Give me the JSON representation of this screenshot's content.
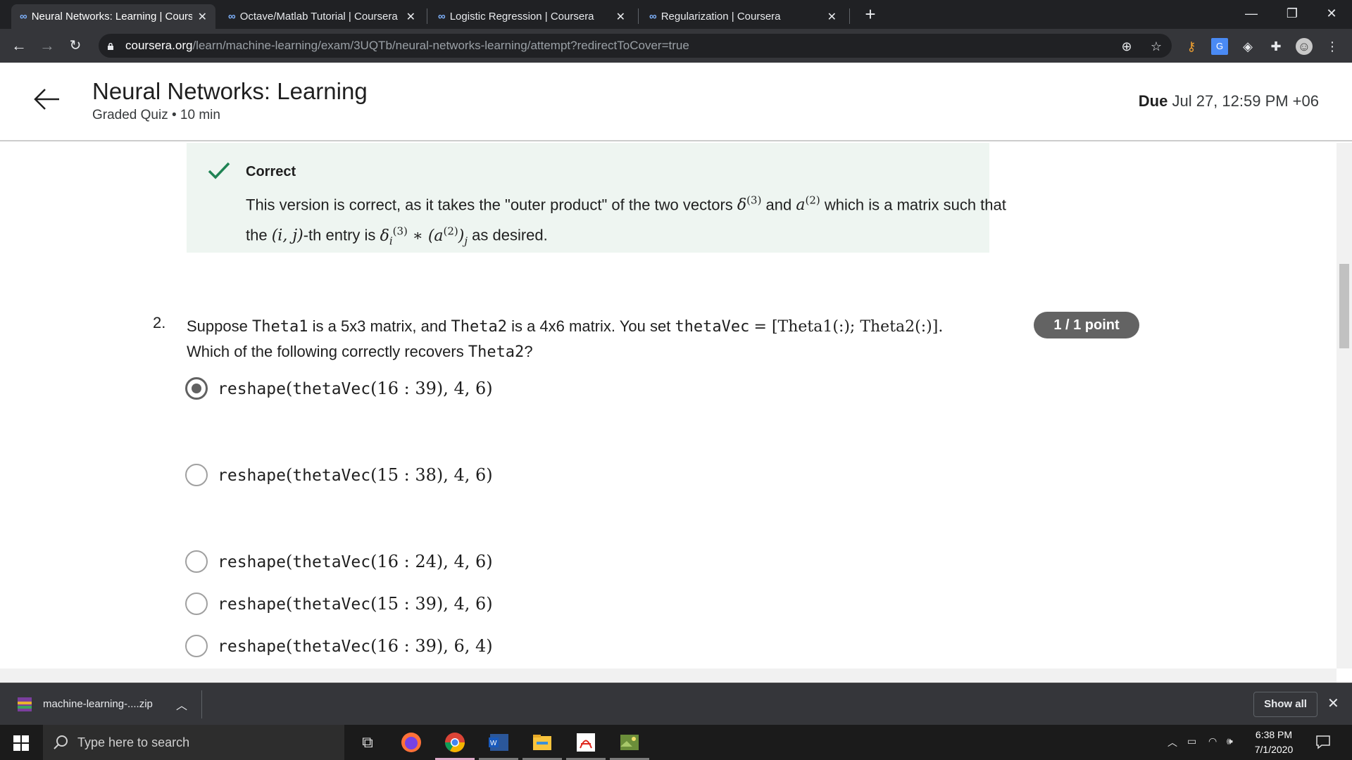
{
  "browser": {
    "tabs": [
      {
        "title": "Neural Networks: Learning | Coursera",
        "active": true
      },
      {
        "title": "Octave/Matlab Tutorial | Coursera",
        "active": false
      },
      {
        "title": "Logistic Regression | Coursera",
        "active": false
      },
      {
        "title": "Regularization | Coursera",
        "active": false
      }
    ],
    "new_tab": "+",
    "url_host": "coursera.org",
    "url_path": "/learn/machine-learning/exam/3UQTb/neural-networks-learning/attempt?redirectToCover=true"
  },
  "header": {
    "title": "Neural Networks: Learning",
    "subtitle": "Graded Quiz • 10 min",
    "due_label": "Due",
    "due_value": "Jul 27, 12:59 PM +06"
  },
  "feedback": {
    "label": "Correct",
    "text_1": "This version is correct, as it takes the \"outer product\" of the two vectors",
    "and": "and",
    "text_2": "which is a matrix such that",
    "line2_the": "the",
    "line2_entry": "-th entry is",
    "line2_end": "as desired."
  },
  "question": {
    "number": "2.",
    "text_a": "Suppose",
    "theta1": "Theta1",
    "text_b": "is a 5x3 matrix, and",
    "theta2": "Theta2",
    "text_c": "is a 4x6 matrix. You set",
    "thetavec": "thetaVec",
    "assign": "= [Theta1(:); Theta2(:)].",
    "line2_a": "Which of the following correctly recovers",
    "line2_theta2": "Theta2",
    "line2_end": "?",
    "points": "1 / 1 point",
    "options": [
      {
        "fn": "reshape",
        "arg": "thetaVec",
        "args": "(16 : 39), 4, 6)",
        "selected": true
      },
      {
        "fn": "reshape",
        "arg": "thetaVec",
        "args": "(15 : 38), 4, 6)",
        "selected": false
      },
      {
        "fn": "reshape",
        "arg": "thetaVec",
        "args": "(16 : 24), 4, 6)",
        "selected": false
      },
      {
        "fn": "reshape",
        "arg": "thetaVec",
        "args": "(15 : 39), 4, 6)",
        "selected": false
      },
      {
        "fn": "reshape",
        "arg": "thetaVec",
        "args": "(16 : 39), 6, 4)",
        "selected": false
      }
    ]
  },
  "download_bar": {
    "file": "machine-learning-....zip",
    "show_all": "Show all"
  },
  "taskbar": {
    "search_placeholder": "Type here to search",
    "time": "6:38 PM",
    "date": "7/1/2020"
  }
}
